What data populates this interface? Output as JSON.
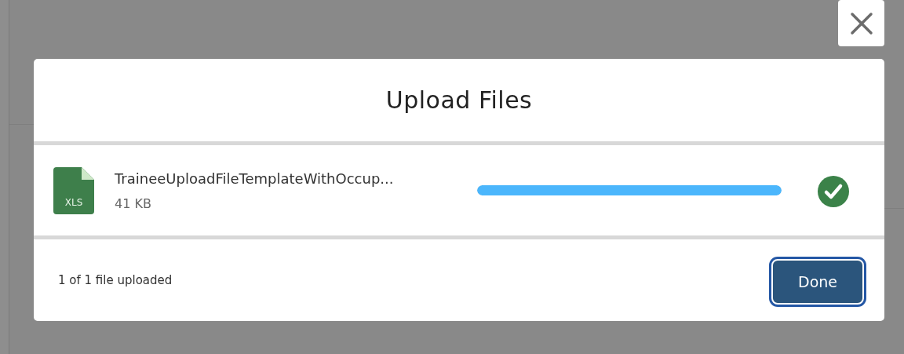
{
  "dialog": {
    "title": "Upload Files"
  },
  "files": [
    {
      "type_label": "XLS",
      "name": "TraineeUploadFileTemplateWithOccup...",
      "size": "41 KB",
      "level": 1,
      "complete": true
    }
  ],
  "footer": {
    "status": "1 of 1 file uploaded",
    "button": "Done"
  }
}
